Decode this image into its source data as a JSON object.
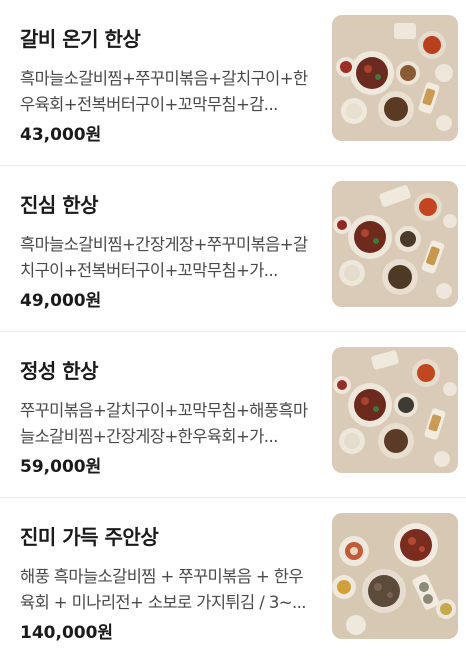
{
  "menu": {
    "items": [
      {
        "name": "갈비 온기 한상",
        "description": "흑마늘소갈비찜+쭈꾸미볶음+갈치구이+한우육회+전복버터구이+꼬막무침+감...",
        "price": "43,000원",
        "image_icon": "food-photo-icon"
      },
      {
        "name": "진심 한상",
        "description": "흑마늘소갈비찜+간장게장+쭈꾸미볶음+갈치구이+전복버터구이+꼬막무침+가...",
        "price": "49,000원",
        "image_icon": "food-photo-icon"
      },
      {
        "name": "정성 한상",
        "description": "쭈꾸미볶음+갈치구이+꼬막무침+해풍흑마늘소갈비찜+간장게장+한우육회+가...",
        "price": "59,000원",
        "image_icon": "food-photo-icon"
      },
      {
        "name": "진미 가득 주안상",
        "description": "해풍 흑마늘소갈비찜 + 쭈꾸미볶음 + 한우육회 + 미나리전+ 소보로 가지튀김 / 3~...",
        "price": "140,000원",
        "image_icon": "food-photo-icon"
      }
    ]
  },
  "colors": {
    "background": "#ffffff",
    "text_primary": "#1a1a1a",
    "text_secondary": "#4a4a4a",
    "divider": "#ececec",
    "photo_table": "#d9cbb7"
  }
}
